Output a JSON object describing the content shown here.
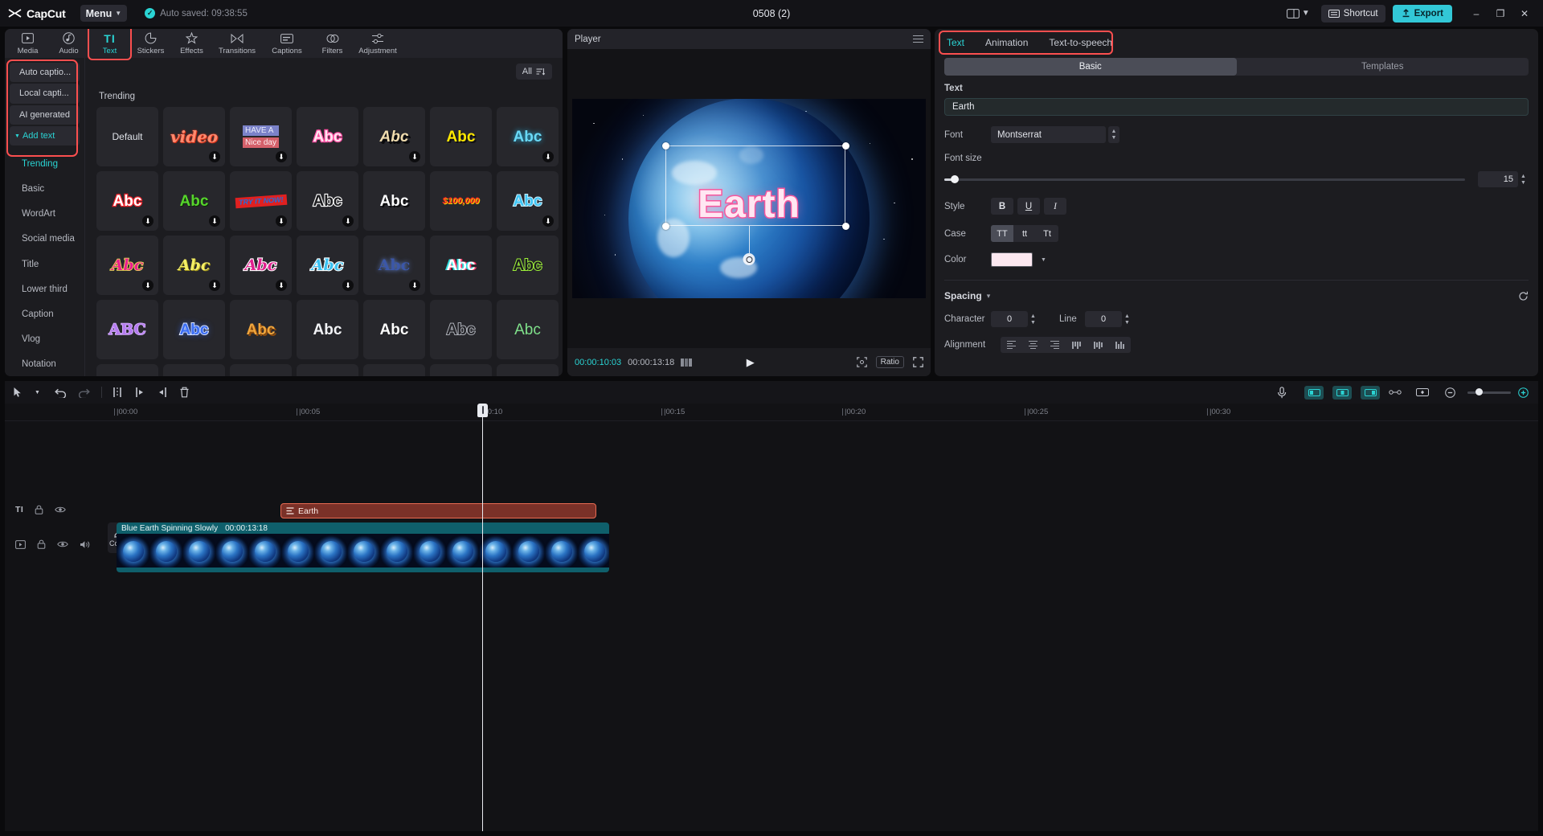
{
  "titlebar": {
    "brand": "CapCut",
    "menu_label": "Menu",
    "autosave_text": "Auto  saved: 09:38:55",
    "project_title": "0508 (2)",
    "shortcut_label": "Shortcut",
    "export_label": "Export",
    "window_minimize": "–",
    "window_maximize": "❐",
    "window_close": "✕"
  },
  "nav_tabs": [
    {
      "label": "Media",
      "icon": "media-icon"
    },
    {
      "label": "Audio",
      "icon": "audio-icon"
    },
    {
      "label": "Text",
      "icon": "text-icon"
    },
    {
      "label": "Stickers",
      "icon": "stickers-icon"
    },
    {
      "label": "Effects",
      "icon": "effects-icon"
    },
    {
      "label": "Transitions",
      "icon": "transitions-icon"
    },
    {
      "label": "Captions",
      "icon": "captions-icon"
    },
    {
      "label": "Filters",
      "icon": "filters-icon"
    },
    {
      "label": "Adjustment",
      "icon": "adjustment-icon"
    }
  ],
  "left_sidebar": {
    "actions": [
      {
        "label": "Auto captio...",
        "name": "auto-captions"
      },
      {
        "label": "Local capti...",
        "name": "local-captions"
      },
      {
        "label": "AI generated",
        "name": "ai-generated"
      },
      {
        "label": "Add text",
        "name": "add-text",
        "caret": "▾"
      }
    ],
    "categories": [
      "Trending",
      "Basic",
      "WordArt",
      "Social media",
      "Title",
      "Lower third",
      "Caption",
      "Vlog",
      "Notation"
    ]
  },
  "templates": {
    "filter_label": "All",
    "section_title": "Trending",
    "download_glyph": "⬇",
    "items": [
      {
        "label": "Default",
        "style": "plain",
        "download": false
      },
      {
        "label": "video",
        "style": "script-orange",
        "download": true
      },
      {
        "label": "HAVE A Nice day",
        "style": "haveaniceday",
        "download": true
      },
      {
        "label": "Abc",
        "style": "pink-outline",
        "download": false
      },
      {
        "label": "Abc",
        "style": "gold-shadow",
        "download": true
      },
      {
        "label": "Abc",
        "style": "yellow-black",
        "download": false
      },
      {
        "label": "Abc",
        "style": "cyan-glow",
        "download": true
      },
      {
        "label": "Abc",
        "style": "red-white",
        "download": true
      },
      {
        "label": "Abc",
        "style": "green-bold",
        "download": true
      },
      {
        "label": "TRY IT NOW!",
        "style": "tryitnow",
        "download": true
      },
      {
        "label": "Abc",
        "style": "white-outline",
        "download": true
      },
      {
        "label": "Abc",
        "style": "white-shadow",
        "download": false
      },
      {
        "label": "$100,000",
        "style": "money",
        "download": false
      },
      {
        "label": "Abc",
        "style": "cyan-blue",
        "download": true
      },
      {
        "label": "Abc",
        "style": "pink-script-yellow",
        "download": true
      },
      {
        "label": "Abc",
        "style": "yellow-script",
        "download": true
      },
      {
        "label": "Abc",
        "style": "magenta-script",
        "download": true
      },
      {
        "label": "Abc",
        "style": "sky-script",
        "download": true
      },
      {
        "label": "Abc",
        "style": "navy-serif",
        "download": true
      },
      {
        "label": "Abc",
        "style": "white-chroma",
        "download": false
      },
      {
        "label": "Abc",
        "style": "lime-outline",
        "download": false
      },
      {
        "label": "ABC",
        "style": "violet-serif",
        "download": false
      },
      {
        "label": "Abc",
        "style": "blue-glow",
        "download": false
      },
      {
        "label": "Abc",
        "style": "orange-3d",
        "download": false
      },
      {
        "label": "Abc",
        "style": "plain-white",
        "download": false
      },
      {
        "label": "Abc",
        "style": "bold-white",
        "download": false
      },
      {
        "label": "Abc",
        "style": "grey-outline",
        "download": false
      },
      {
        "label": "Abc",
        "style": "green-thin",
        "download": false
      }
    ]
  },
  "player": {
    "title": "Player",
    "overlay_text": "Earth",
    "current_time": "00:00:10:03",
    "total_time": "00:00:13:18",
    "play_glyph": "▶",
    "ratio_label": "Ratio",
    "fullscreen_glyph": "⤡",
    "crop_glyph": "⬚"
  },
  "right_panel": {
    "tabs": [
      "Text",
      "Animation",
      "Text-to-speech"
    ],
    "active_tab": "Text",
    "segments": [
      "Basic",
      "Templates"
    ],
    "active_segment": "Basic",
    "text_label": "Text",
    "text_value": "Earth",
    "font_label": "Font",
    "font_value": "Montserrat",
    "font_size_label": "Font size",
    "font_size_value": "15",
    "style_label": "Style",
    "style_buttons": [
      "B",
      "U",
      "I"
    ],
    "case_label": "Case",
    "case_buttons": [
      "TT",
      "tt",
      "Tt"
    ],
    "case_active": "TT",
    "color_label": "Color",
    "color_value": "#fce8f0",
    "spacing_title": "Spacing",
    "character_label": "Character",
    "character_value": "0",
    "line_label": "Line",
    "line_value": "0",
    "alignment_label": "Alignment"
  },
  "timeline": {
    "toolbar": {
      "select_glyph": "➤",
      "undo_glyph": "↶",
      "redo_glyph": "↷",
      "split_glyph": "⌶",
      "trim_left_glyph": "⌶",
      "trim_right_glyph": "⌶",
      "delete_glyph": "⌧",
      "mic_glyph": "Ἲ4",
      "zoom_out_glyph": "⊖",
      "zoom_in_glyph": "⊕"
    },
    "ruler_ticks": [
      "|00:00",
      "|00:05",
      "|00:10",
      "|00:15",
      "|00:20",
      "|00:25",
      "|00:30"
    ],
    "cover_label": "Cover",
    "text_clip": {
      "label": "Earth"
    },
    "video_clip": {
      "label": "Blue Earth Spinning Slowly",
      "duration": "00:00:13:18"
    },
    "text_track_icon": "TI"
  }
}
